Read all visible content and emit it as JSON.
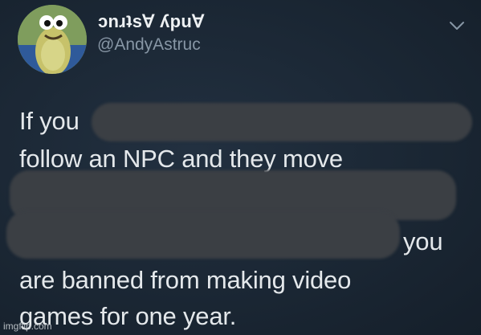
{
  "tweet": {
    "display_name": "ɔnɹʇsⱯ ʎpuⱯ",
    "handle": "@AndyAstruc",
    "menu_icon": "chevron-down-icon",
    "avatar_icon": "fish-cartoon-avatar",
    "lines": [
      "If you",
      "follow an NPC and they move",
      "you",
      "are banned from making video",
      "games for one year."
    ]
  },
  "watermark": "imgflip.com",
  "colors": {
    "background": "#1b2734",
    "text": "#e4e8eb",
    "handle": "#8796a5",
    "redaction": "#3b3f44"
  }
}
